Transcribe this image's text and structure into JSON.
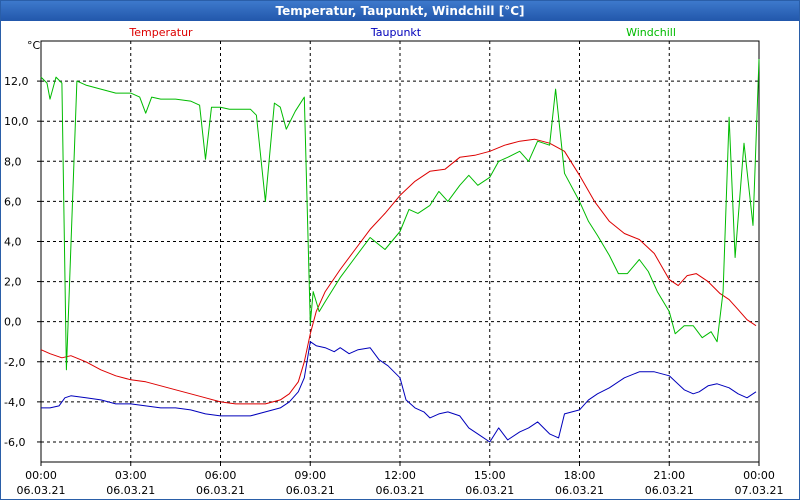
{
  "window": {
    "title": "Temperatur, Taupunkt, Windchill [°C]"
  },
  "chart_data": {
    "type": "line",
    "title": "Temperatur, Taupunkt, Windchill [°C]",
    "ylabel": "°C",
    "xlabel": "",
    "ylim": [
      -7.0,
      14.0
    ],
    "xlim": [
      0,
      24
    ],
    "grid": true,
    "legend_position": "top",
    "y_ticks": [
      -6,
      -4,
      -2,
      0,
      2,
      4,
      6,
      8,
      10,
      12
    ],
    "y_tick_labels": [
      "-6,0",
      "-4,0",
      "-2,0",
      "0,0",
      "2,0",
      "4,0",
      "6,0",
      "8,0",
      "10,0",
      "12,0"
    ],
    "x_ticks": [
      {
        "hour": 0,
        "time": "00:00",
        "date": "06.03.21"
      },
      {
        "hour": 3,
        "time": "03:00",
        "date": "06.03.21"
      },
      {
        "hour": 6,
        "time": "06:00",
        "date": "06.03.21"
      },
      {
        "hour": 9,
        "time": "09:00",
        "date": "06.03.21"
      },
      {
        "hour": 12,
        "time": "12:00",
        "date": "06.03.21"
      },
      {
        "hour": 15,
        "time": "15:00",
        "date": "06.03.21"
      },
      {
        "hour": 18,
        "time": "18:00",
        "date": "06.03.21"
      },
      {
        "hour": 21,
        "time": "21:00",
        "date": "06.03.21"
      },
      {
        "hour": 24,
        "time": "00:00",
        "date": "07.03.21"
      }
    ],
    "series": [
      {
        "name": "Temperatur",
        "color": "#dd0000",
        "points": [
          [
            0,
            -1.4
          ],
          [
            0.3,
            -1.6
          ],
          [
            0.7,
            -1.8
          ],
          [
            1,
            -1.7
          ],
          [
            1.5,
            -2.0
          ],
          [
            2,
            -2.4
          ],
          [
            2.5,
            -2.7
          ],
          [
            3,
            -2.9
          ],
          [
            3.5,
            -3.0
          ],
          [
            4,
            -3.2
          ],
          [
            4.5,
            -3.4
          ],
          [
            5,
            -3.6
          ],
          [
            5.5,
            -3.8
          ],
          [
            6,
            -4.0
          ],
          [
            6.5,
            -4.1
          ],
          [
            7,
            -4.1
          ],
          [
            7.5,
            -4.1
          ],
          [
            8,
            -3.9
          ],
          [
            8.3,
            -3.6
          ],
          [
            8.6,
            -3.0
          ],
          [
            8.8,
            -2.0
          ],
          [
            9,
            -0.6
          ],
          [
            9.2,
            0.5
          ],
          [
            9.5,
            1.5
          ],
          [
            10,
            2.6
          ],
          [
            10.5,
            3.6
          ],
          [
            11,
            4.6
          ],
          [
            11.5,
            5.4
          ],
          [
            12,
            6.3
          ],
          [
            12.5,
            7.0
          ],
          [
            13,
            7.5
          ],
          [
            13.5,
            7.6
          ],
          [
            14,
            8.2
          ],
          [
            14.5,
            8.3
          ],
          [
            15,
            8.5
          ],
          [
            15.5,
            8.8
          ],
          [
            16,
            9.0
          ],
          [
            16.5,
            9.1
          ],
          [
            17,
            8.9
          ],
          [
            17.5,
            8.5
          ],
          [
            18,
            7.3
          ],
          [
            18.5,
            6.0
          ],
          [
            19,
            5.0
          ],
          [
            19.5,
            4.4
          ],
          [
            20,
            4.1
          ],
          [
            20.5,
            3.4
          ],
          [
            21,
            2.1
          ],
          [
            21.3,
            1.8
          ],
          [
            21.6,
            2.3
          ],
          [
            21.9,
            2.4
          ],
          [
            22.3,
            2.0
          ],
          [
            22.7,
            1.4
          ],
          [
            23,
            1.1
          ],
          [
            23.3,
            0.6
          ],
          [
            23.6,
            0.1
          ],
          [
            23.9,
            -0.2
          ]
        ]
      },
      {
        "name": "Taupunkt",
        "color": "#0000bb",
        "points": [
          [
            0,
            -4.3
          ],
          [
            0.3,
            -4.3
          ],
          [
            0.6,
            -4.2
          ],
          [
            0.8,
            -3.8
          ],
          [
            1,
            -3.7
          ],
          [
            1.5,
            -3.8
          ],
          [
            2,
            -3.9
          ],
          [
            2.5,
            -4.1
          ],
          [
            3,
            -4.1
          ],
          [
            3.5,
            -4.2
          ],
          [
            4,
            -4.3
          ],
          [
            4.5,
            -4.3
          ],
          [
            5,
            -4.4
          ],
          [
            5.5,
            -4.6
          ],
          [
            6,
            -4.7
          ],
          [
            6.5,
            -4.7
          ],
          [
            7,
            -4.7
          ],
          [
            7.5,
            -4.5
          ],
          [
            8,
            -4.3
          ],
          [
            8.3,
            -4.0
          ],
          [
            8.6,
            -3.5
          ],
          [
            8.8,
            -2.8
          ],
          [
            9,
            -1.0
          ],
          [
            9.2,
            -1.2
          ],
          [
            9.5,
            -1.3
          ],
          [
            9.8,
            -1.5
          ],
          [
            10,
            -1.3
          ],
          [
            10.3,
            -1.6
          ],
          [
            10.6,
            -1.4
          ],
          [
            11,
            -1.3
          ],
          [
            11.3,
            -1.9
          ],
          [
            11.6,
            -2.2
          ],
          [
            12,
            -2.8
          ],
          [
            12.2,
            -3.9
          ],
          [
            12.5,
            -4.3
          ],
          [
            12.8,
            -4.5
          ],
          [
            13,
            -4.8
          ],
          [
            13.3,
            -4.6
          ],
          [
            13.6,
            -4.5
          ],
          [
            14,
            -4.7
          ],
          [
            14.3,
            -5.3
          ],
          [
            14.6,
            -5.6
          ],
          [
            15,
            -6.0
          ],
          [
            15.3,
            -5.3
          ],
          [
            15.6,
            -5.9
          ],
          [
            16,
            -5.5
          ],
          [
            16.3,
            -5.3
          ],
          [
            16.6,
            -5.0
          ],
          [
            17,
            -5.6
          ],
          [
            17.3,
            -5.8
          ],
          [
            17.5,
            -4.6
          ],
          [
            18,
            -4.4
          ],
          [
            18.3,
            -3.9
          ],
          [
            18.6,
            -3.6
          ],
          [
            19,
            -3.3
          ],
          [
            19.5,
            -2.8
          ],
          [
            20,
            -2.5
          ],
          [
            20.5,
            -2.5
          ],
          [
            21,
            -2.7
          ],
          [
            21.5,
            -3.4
          ],
          [
            21.8,
            -3.6
          ],
          [
            22,
            -3.5
          ],
          [
            22.3,
            -3.2
          ],
          [
            22.6,
            -3.1
          ],
          [
            23,
            -3.3
          ],
          [
            23.3,
            -3.6
          ],
          [
            23.6,
            -3.8
          ],
          [
            23.9,
            -3.5
          ]
        ]
      },
      {
        "name": "Windchill",
        "color": "#00bb00",
        "points": [
          [
            0,
            12.2
          ],
          [
            0.2,
            11.9
          ],
          [
            0.3,
            11.1
          ],
          [
            0.5,
            12.2
          ],
          [
            0.7,
            11.9
          ],
          [
            0.85,
            -2.4
          ],
          [
            1.2,
            12.0
          ],
          [
            1.5,
            11.8
          ],
          [
            2,
            11.6
          ],
          [
            2.5,
            11.4
          ],
          [
            3,
            11.4
          ],
          [
            3.3,
            11.2
          ],
          [
            3.5,
            10.4
          ],
          [
            3.7,
            11.2
          ],
          [
            4,
            11.1
          ],
          [
            4.5,
            11.1
          ],
          [
            5,
            11.0
          ],
          [
            5.3,
            10.8
          ],
          [
            5.5,
            8.1
          ],
          [
            5.7,
            10.7
          ],
          [
            6,
            10.7
          ],
          [
            6.3,
            10.6
          ],
          [
            6.6,
            10.6
          ],
          [
            7,
            10.6
          ],
          [
            7.2,
            10.3
          ],
          [
            7.5,
            6.0
          ],
          [
            7.8,
            10.9
          ],
          [
            8,
            10.7
          ],
          [
            8.2,
            9.6
          ],
          [
            8.5,
            10.5
          ],
          [
            8.8,
            11.2
          ],
          [
            9,
            -0.1
          ],
          [
            9.1,
            1.5
          ],
          [
            9.3,
            0.5
          ],
          [
            9.5,
            1.0
          ],
          [
            10,
            2.2
          ],
          [
            10.5,
            3.2
          ],
          [
            11,
            4.2
          ],
          [
            11.5,
            3.6
          ],
          [
            12,
            4.5
          ],
          [
            12.3,
            5.6
          ],
          [
            12.6,
            5.4
          ],
          [
            13,
            5.8
          ],
          [
            13.3,
            6.5
          ],
          [
            13.6,
            6.0
          ],
          [
            14,
            6.8
          ],
          [
            14.3,
            7.3
          ],
          [
            14.6,
            6.8
          ],
          [
            15,
            7.2
          ],
          [
            15.3,
            8.0
          ],
          [
            15.6,
            8.2
          ],
          [
            16,
            8.5
          ],
          [
            16.3,
            8.0
          ],
          [
            16.6,
            9.0
          ],
          [
            17,
            8.8
          ],
          [
            17.2,
            11.6
          ],
          [
            17.5,
            7.4
          ],
          [
            18,
            6.0
          ],
          [
            18.3,
            5.0
          ],
          [
            18.6,
            4.3
          ],
          [
            19,
            3.3
          ],
          [
            19.3,
            2.4
          ],
          [
            19.6,
            2.4
          ],
          [
            20,
            3.1
          ],
          [
            20.3,
            2.5
          ],
          [
            20.6,
            1.5
          ],
          [
            21,
            0.5
          ],
          [
            21.2,
            -0.6
          ],
          [
            21.5,
            -0.2
          ],
          [
            21.8,
            -0.2
          ],
          [
            22.1,
            -0.8
          ],
          [
            22.4,
            -0.5
          ],
          [
            22.6,
            -1.0
          ],
          [
            22.8,
            1.5
          ],
          [
            23,
            10.2
          ],
          [
            23.2,
            3.2
          ],
          [
            23.5,
            8.9
          ],
          [
            23.8,
            4.8
          ],
          [
            24,
            13.1
          ]
        ]
      }
    ]
  }
}
